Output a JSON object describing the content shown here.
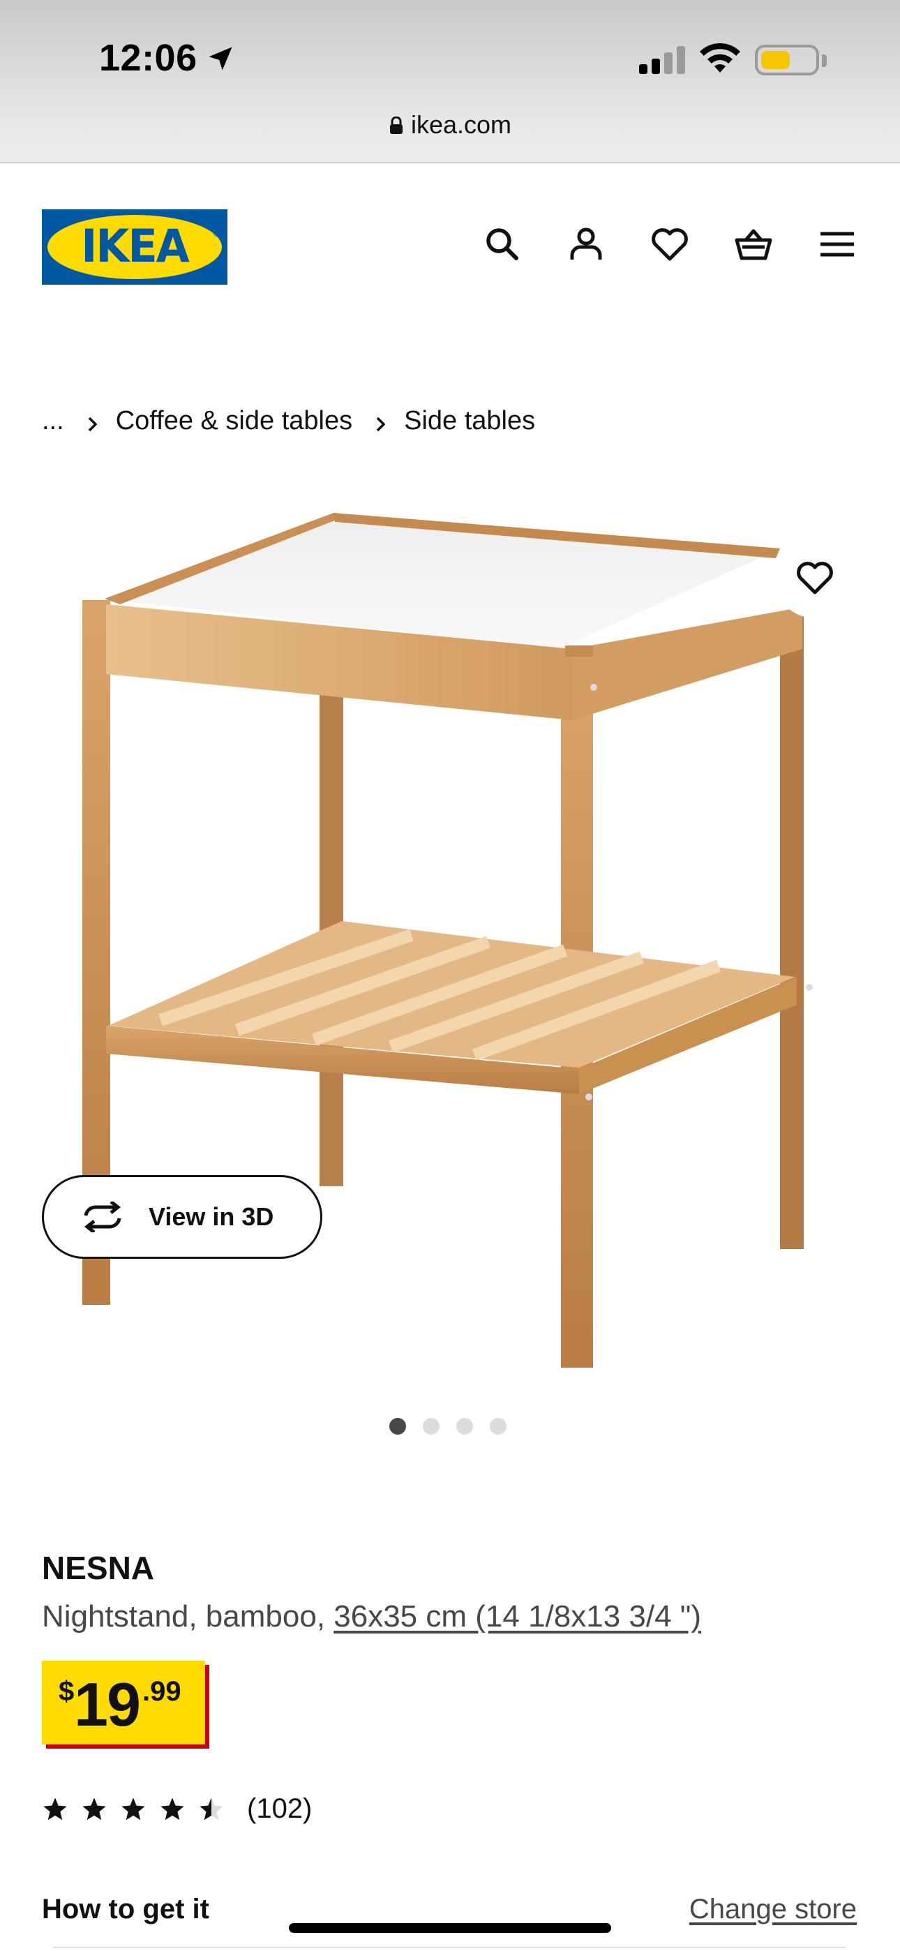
{
  "status_bar": {
    "time": "12:06",
    "battery_level": 0.55,
    "battery_color": "#f7c600"
  },
  "browser": {
    "url": "ikea.com"
  },
  "header": {
    "logo_text": "IKEA",
    "icons": [
      "search-icon",
      "account-icon",
      "heart-icon",
      "cart-icon",
      "menu-icon"
    ],
    "brand_blue": "#0058a3",
    "brand_yellow": "#ffdb00"
  },
  "breadcrumb": {
    "items": [
      "...",
      "Coffee & side tables",
      "Side tables"
    ]
  },
  "gallery": {
    "view_3d_label": "View in 3D",
    "image_count": 4,
    "active_index": 0
  },
  "product": {
    "name": "NESNA",
    "description_prefix": "Nightstand, bamboo, ",
    "measurements": "36x35 cm (14 1/8x13 3/4 \")",
    "price": {
      "currency": "$",
      "integer": "19",
      "decimal": ".99"
    },
    "rating": {
      "stars": 4.5,
      "count_label": "(102)"
    }
  },
  "fulfillment": {
    "how_label": "How to get it",
    "change_store_label": "Change store"
  }
}
